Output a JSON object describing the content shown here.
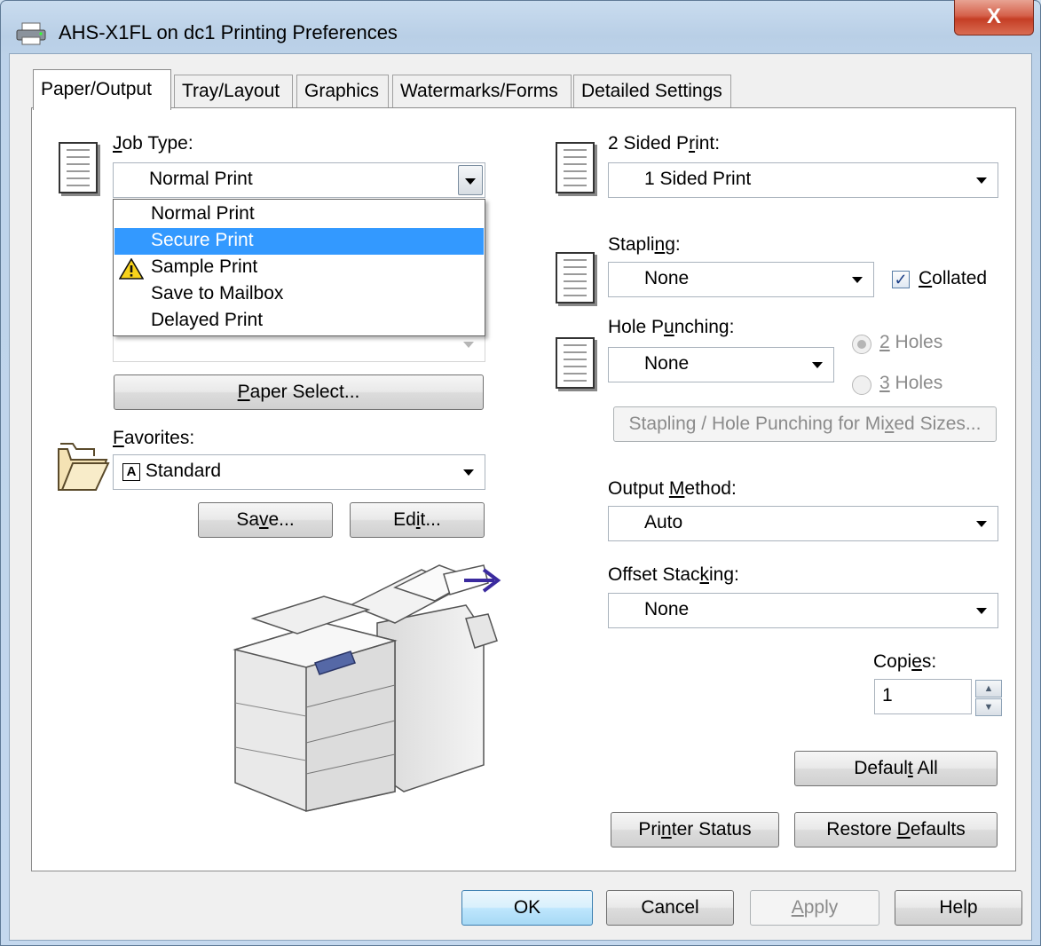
{
  "window": {
    "title": "AHS-X1FL on dc1 Printing Preferences",
    "close_label": "X"
  },
  "tabs": [
    {
      "label": "Paper/Output"
    },
    {
      "label": "Tray/Layout"
    },
    {
      "label": "Graphics"
    },
    {
      "label": "Watermarks/Forms"
    },
    {
      "label": "Detailed Settings"
    }
  ],
  "job_type": {
    "label_mnemonic": "J",
    "label_rest": "ob Type:",
    "value": "Normal Print",
    "options": [
      "Normal Print",
      "Secure Print",
      "Sample Print",
      "Save to Mailbox",
      "Delayed Print"
    ],
    "highlighted": "Secure Print"
  },
  "paper_select": {
    "pre": "",
    "mnemonic": "P",
    "post": "aper Select..."
  },
  "favorites": {
    "mnemonic": "F",
    "rest": "avorites:",
    "value": "Standard",
    "badge": "A"
  },
  "save_button": {
    "pre": "Sa",
    "mnemonic": "v",
    "post": "e..."
  },
  "edit_button": {
    "pre": "Ed",
    "mnemonic": "i",
    "post": "t..."
  },
  "two_sided": {
    "pre": "2 Sided P",
    "mnemonic": "r",
    "post": "int:",
    "value": "1 Sided Print"
  },
  "stapling": {
    "pre": "Stapli",
    "mnemonic": "n",
    "post": "g:",
    "value": "None"
  },
  "collated": {
    "mnemonic": "C",
    "rest": "ollated",
    "checked": true
  },
  "hole_punching": {
    "pre": "Hole P",
    "mnemonic": "u",
    "post": "nching:",
    "value": "None"
  },
  "holes": [
    {
      "mnemonic": "2",
      "rest": " Holes",
      "selected": true
    },
    {
      "mnemonic": "3",
      "rest": " Holes",
      "selected": false
    }
  ],
  "mixed_sizes": {
    "pre": "Stapling / Hole Punching for Mi",
    "mnemonic": "x",
    "post": "ed Sizes..."
  },
  "output_method": {
    "pre": "Output ",
    "mnemonic": "M",
    "post": "ethod:",
    "value": "Auto"
  },
  "offset_stacking": {
    "pre": "Offset Stac",
    "mnemonic": "k",
    "post": "ing:",
    "value": "None"
  },
  "copies": {
    "pre": "Copi",
    "mnemonic": "e",
    "post": "s:",
    "value": "1"
  },
  "default_all": {
    "pre": "Defaul",
    "mnemonic": "t",
    "post": " All"
  },
  "printer_status": {
    "pre": "Pri",
    "mnemonic": "n",
    "post": "ter Status"
  },
  "restore_defaults": {
    "pre": "Restore ",
    "mnemonic": "D",
    "post": "efaults"
  },
  "footer": {
    "ok": "OK",
    "cancel": "Cancel",
    "apply_mnemonic": "A",
    "apply_rest": "pply",
    "help": "Help"
  },
  "colors": {
    "selection": "#3399ff",
    "accent_arrow": "#3a2a9e",
    "close": "#c53e25"
  }
}
